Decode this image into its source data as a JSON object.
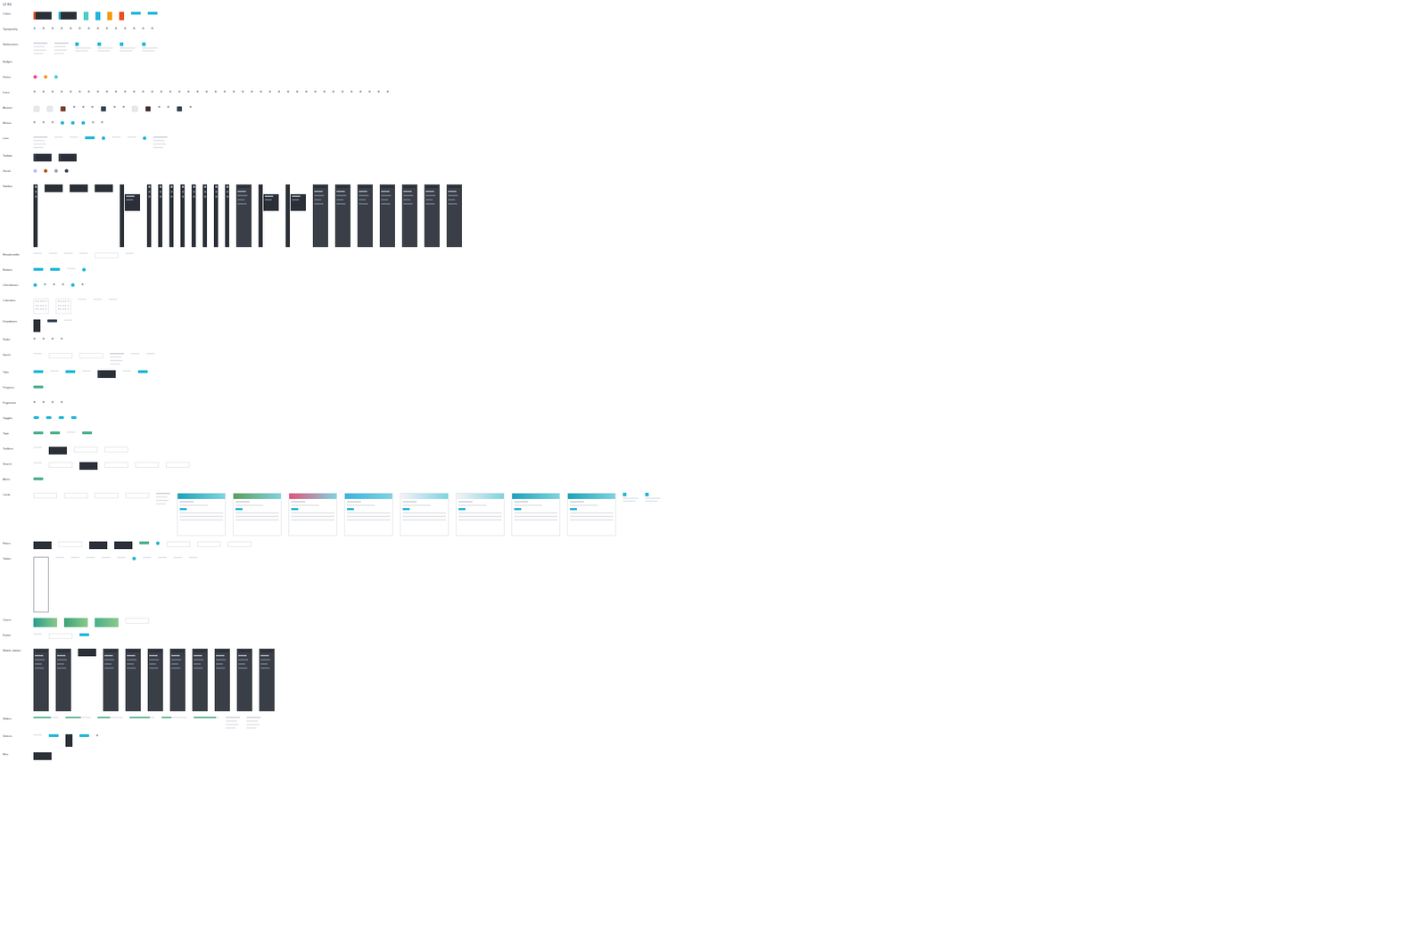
{
  "sheet": {
    "title": "UI Kit"
  },
  "sections": [
    {
      "label": "Colors",
      "items": [
        {
          "kind": "panel",
          "color": "#e8501f"
        },
        {
          "kind": "panel",
          "color": "#1fb6d9"
        },
        {
          "kind": "swatch",
          "color": "#4ecdc4"
        },
        {
          "kind": "swatch",
          "color": "#1fb6d9"
        },
        {
          "kind": "swatch",
          "color": "#f39c12"
        },
        {
          "kind": "swatch",
          "color": "#e8501f"
        },
        {
          "kind": "pill",
          "color": "#1fb6d9"
        },
        {
          "kind": "pill",
          "color": "#1fb6d9"
        }
      ]
    },
    {
      "label": "Typography",
      "items": [
        {
          "kind": "mark"
        },
        {
          "kind": "mark"
        },
        {
          "kind": "mark"
        },
        {
          "kind": "mark"
        },
        {
          "kind": "mark"
        },
        {
          "kind": "mark"
        },
        {
          "kind": "mark"
        },
        {
          "kind": "mark"
        },
        {
          "kind": "mark"
        },
        {
          "kind": "mark"
        },
        {
          "kind": "mark"
        },
        {
          "kind": "mark"
        },
        {
          "kind": "mark"
        },
        {
          "kind": "mark"
        }
      ]
    },
    {
      "label": "Notifications",
      "items": [
        {
          "kind": "list"
        },
        {
          "kind": "list"
        },
        {
          "kind": "note"
        },
        {
          "kind": "note"
        },
        {
          "kind": "note"
        },
        {
          "kind": "note"
        }
      ]
    },
    {
      "label": "Badges",
      "items": []
    },
    {
      "label": "Status",
      "items": [
        {
          "kind": "dot",
          "color": "#e84393"
        },
        {
          "kind": "dot",
          "color": "#f39c12"
        },
        {
          "kind": "dot",
          "color": "#4ecdc4"
        }
      ]
    },
    {
      "label": "Icons",
      "items": [
        {
          "kind": "mark"
        },
        {
          "kind": "mark"
        },
        {
          "kind": "mark"
        },
        {
          "kind": "mark"
        },
        {
          "kind": "mark"
        },
        {
          "kind": "mark"
        },
        {
          "kind": "mark"
        },
        {
          "kind": "mark"
        },
        {
          "kind": "mark"
        },
        {
          "kind": "mark"
        },
        {
          "kind": "mark"
        },
        {
          "kind": "mark"
        },
        {
          "kind": "mark"
        },
        {
          "kind": "mark"
        },
        {
          "kind": "mark"
        },
        {
          "kind": "mark"
        },
        {
          "kind": "mark"
        },
        {
          "kind": "mark"
        },
        {
          "kind": "mark"
        },
        {
          "kind": "mark"
        },
        {
          "kind": "mark"
        },
        {
          "kind": "mark"
        },
        {
          "kind": "mark"
        },
        {
          "kind": "mark"
        },
        {
          "kind": "mark"
        },
        {
          "kind": "mark"
        },
        {
          "kind": "mark"
        },
        {
          "kind": "mark"
        },
        {
          "kind": "mark"
        },
        {
          "kind": "mark"
        },
        {
          "kind": "mark"
        },
        {
          "kind": "mark"
        },
        {
          "kind": "mark"
        },
        {
          "kind": "mark"
        },
        {
          "kind": "mark"
        },
        {
          "kind": "mark"
        },
        {
          "kind": "mark"
        },
        {
          "kind": "mark"
        },
        {
          "kind": "mark"
        },
        {
          "kind": "mark"
        }
      ]
    },
    {
      "label": "Avatars",
      "items": [
        {
          "kind": "avatar",
          "color": "#e5e7eb"
        },
        {
          "kind": "avatar",
          "color": "#e5e7eb"
        },
        {
          "kind": "avatar",
          "color": "#7c3a2e"
        },
        {
          "kind": "mark"
        },
        {
          "kind": "mark"
        },
        {
          "kind": "mark"
        },
        {
          "kind": "avatar",
          "color": "#374151"
        },
        {
          "kind": "mark"
        },
        {
          "kind": "mark"
        },
        {
          "kind": "avatar",
          "color": "#e5e7eb"
        },
        {
          "kind": "avatar",
          "color": "#4b2e2e"
        },
        {
          "kind": "mark"
        },
        {
          "kind": "mark"
        },
        {
          "kind": "avatar",
          "color": "#374151"
        },
        {
          "kind": "mark"
        }
      ]
    },
    {
      "label": "Menus",
      "items": [
        {
          "kind": "mark"
        },
        {
          "kind": "mark"
        },
        {
          "kind": "mark"
        },
        {
          "kind": "dot",
          "color": "#1fb6d9"
        },
        {
          "kind": "dot",
          "color": "#1fb6d9"
        },
        {
          "kind": "dot",
          "color": "#1fb6d9"
        },
        {
          "kind": "mark"
        },
        {
          "kind": "mark"
        }
      ]
    },
    {
      "label": "Lists",
      "items": [
        {
          "kind": "list"
        },
        {
          "kind": "line"
        },
        {
          "kind": "line"
        },
        {
          "kind": "pill",
          "color": "#1fb6d9"
        },
        {
          "kind": "dot",
          "color": "#1fb6d9"
        },
        {
          "kind": "line"
        },
        {
          "kind": "line"
        },
        {
          "kind": "dot",
          "color": "#1fb6d9"
        },
        {
          "kind": "list"
        }
      ]
    },
    {
      "label": "Tooltips",
      "items": [
        {
          "kind": "panel",
          "color": "#374151"
        },
        {
          "kind": "panel",
          "color": "#374151"
        }
      ]
    },
    {
      "label": "Social",
      "items": [
        {
          "kind": "dot",
          "color": "#c4b5fd"
        },
        {
          "kind": "dot",
          "color": "#b45309"
        },
        {
          "kind": "dot",
          "color": "#9ca3af"
        },
        {
          "kind": "dot",
          "color": "#374151"
        }
      ]
    },
    {
      "label": "Sidebar",
      "items": [
        {
          "kind": "rail"
        },
        {
          "kind": "panel",
          "color": "#2b3038"
        },
        {
          "kind": "panel",
          "color": "#2b3038"
        },
        {
          "kind": "panel",
          "color": "#2b3038"
        },
        {
          "kind": "menu"
        },
        {
          "kind": "rail"
        },
        {
          "kind": "rail"
        },
        {
          "kind": "rail"
        },
        {
          "kind": "rail"
        },
        {
          "kind": "rail"
        },
        {
          "kind": "rail"
        },
        {
          "kind": "rail"
        },
        {
          "kind": "rail"
        },
        {
          "kind": "sidebar"
        },
        {
          "kind": "menu"
        },
        {
          "kind": "menu"
        },
        {
          "kind": "sidebar"
        },
        {
          "kind": "sidebar"
        },
        {
          "kind": "sidebar"
        },
        {
          "kind": "sidebar"
        },
        {
          "kind": "sidebar"
        },
        {
          "kind": "sidebar"
        },
        {
          "kind": "sidebar"
        }
      ]
    },
    {
      "label": "Breadcrumbs",
      "items": [
        {
          "kind": "line"
        },
        {
          "kind": "line"
        },
        {
          "kind": "line"
        },
        {
          "kind": "line"
        },
        {
          "kind": "box"
        },
        {
          "kind": "line"
        }
      ]
    },
    {
      "label": "Buttons",
      "items": [
        {
          "kind": "pill",
          "color": "#1fb6d9"
        },
        {
          "kind": "pill",
          "color": "#1fb6d9"
        },
        {
          "kind": "line"
        },
        {
          "kind": "dot",
          "color": "#1fb6d9"
        }
      ]
    },
    {
      "label": "Checkboxes",
      "items": [
        {
          "kind": "dot",
          "color": "#1fb6d9"
        },
        {
          "kind": "mark"
        },
        {
          "kind": "mark"
        },
        {
          "kind": "mark"
        },
        {
          "kind": "dot",
          "color": "#1fb6d9"
        },
        {
          "kind": "mark"
        }
      ]
    },
    {
      "label": "Calendars",
      "items": [
        {
          "kind": "calendar"
        },
        {
          "kind": "calendar"
        },
        {
          "kind": "line"
        },
        {
          "kind": "line"
        },
        {
          "kind": "line"
        }
      ]
    },
    {
      "label": "Dropdowns",
      "items": [
        {
          "kind": "menu-small"
        },
        {
          "kind": "pill",
          "color": "#374151"
        },
        {
          "kind": "line"
        }
      ]
    },
    {
      "label": "Radio",
      "items": [
        {
          "kind": "mark"
        },
        {
          "kind": "mark"
        },
        {
          "kind": "mark"
        },
        {
          "kind": "mark"
        }
      ]
    },
    {
      "label": "Inputs",
      "items": [
        {
          "kind": "line"
        },
        {
          "kind": "box"
        },
        {
          "kind": "box"
        },
        {
          "kind": "list"
        },
        {
          "kind": "line"
        },
        {
          "kind": "line"
        }
      ]
    },
    {
      "label": "Tabs",
      "items": [
        {
          "kind": "pill",
          "color": "#1fb6d9"
        },
        {
          "kind": "line"
        },
        {
          "kind": "pill",
          "color": "#1fb6d9"
        },
        {
          "kind": "line"
        },
        {
          "kind": "panel",
          "color": "#374151"
        },
        {
          "kind": "line"
        },
        {
          "kind": "pill",
          "color": "#1fb6d9"
        }
      ]
    },
    {
      "label": "Progress",
      "items": [
        {
          "kind": "pill",
          "color": "#4caf8a"
        }
      ]
    },
    {
      "label": "Pagination",
      "items": [
        {
          "kind": "mark"
        },
        {
          "kind": "mark"
        },
        {
          "kind": "mark"
        },
        {
          "kind": "mark"
        }
      ]
    },
    {
      "label": "Toggles",
      "items": [
        {
          "kind": "toggle"
        },
        {
          "kind": "toggle"
        },
        {
          "kind": "toggle"
        },
        {
          "kind": "toggle"
        }
      ]
    },
    {
      "label": "Tags",
      "items": [
        {
          "kind": "pill",
          "color": "#4caf8a"
        },
        {
          "kind": "pill",
          "color": "#4caf8a"
        },
        {
          "kind": "line"
        },
        {
          "kind": "pill",
          "color": "#4caf8a"
        }
      ]
    },
    {
      "label": "Toolbars",
      "items": [
        {
          "kind": "line"
        },
        {
          "kind": "panel",
          "color": "#2b3038"
        },
        {
          "kind": "box"
        },
        {
          "kind": "box"
        }
      ]
    },
    {
      "label": "Search",
      "items": [
        {
          "kind": "line"
        },
        {
          "kind": "box"
        },
        {
          "kind": "panel",
          "color": "#2b3038"
        },
        {
          "kind": "box"
        },
        {
          "kind": "box"
        },
        {
          "kind": "box"
        }
      ]
    },
    {
      "label": "Alerts",
      "items": [
        {
          "kind": "pill",
          "color": "#4caf8a"
        }
      ]
    },
    {
      "label": "Cards",
      "items": [
        {
          "kind": "box"
        },
        {
          "kind": "box"
        },
        {
          "kind": "box"
        },
        {
          "kind": "box"
        },
        {
          "kind": "list"
        },
        {
          "kind": "card",
          "color": "#1ca3b8"
        },
        {
          "kind": "card",
          "color": "#5aa05a"
        },
        {
          "kind": "card",
          "color": "#e2547a"
        },
        {
          "kind": "card",
          "color": "#3bb3e0"
        },
        {
          "kind": "card",
          "color": "#f3f4f6"
        },
        {
          "kind": "card",
          "color": "#f3f4f6"
        },
        {
          "kind": "card",
          "color": "#1ca3b8"
        },
        {
          "kind": "card",
          "color": "#1ca3b8"
        },
        {
          "kind": "note"
        },
        {
          "kind": "note"
        }
      ]
    },
    {
      "label": "Filters",
      "items": [
        {
          "kind": "panel",
          "color": "#2b3038"
        },
        {
          "kind": "box"
        },
        {
          "kind": "panel",
          "color": "#2b3038"
        },
        {
          "kind": "panel",
          "color": "#2b3038"
        },
        {
          "kind": "pill",
          "color": "#4caf8a"
        },
        {
          "kind": "dot",
          "color": "#1fb6d9"
        },
        {
          "kind": "box"
        },
        {
          "kind": "box"
        },
        {
          "kind": "box"
        }
      ]
    },
    {
      "label": "Tables",
      "items": [
        {
          "kind": "tall"
        },
        {
          "kind": "line"
        },
        {
          "kind": "line"
        },
        {
          "kind": "line"
        },
        {
          "kind": "line"
        },
        {
          "kind": "line"
        },
        {
          "kind": "dot",
          "color": "#1fb6d9"
        },
        {
          "kind": "line"
        },
        {
          "kind": "line"
        },
        {
          "kind": "line"
        },
        {
          "kind": "line"
        }
      ]
    },
    {
      "label": "Charts",
      "items": [
        {
          "kind": "banner",
          "color": "#2a9d8f"
        },
        {
          "kind": "banner",
          "color": "#3aa37a"
        },
        {
          "kind": "banner",
          "color": "#4caf8a"
        },
        {
          "kind": "box"
        }
      ]
    },
    {
      "label": "Footer",
      "items": [
        {
          "kind": "line"
        },
        {
          "kind": "box"
        },
        {
          "kind": "pill",
          "color": "#1fb6d9"
        }
      ]
    },
    {
      "label": "Mobile sidebar",
      "items": [
        {
          "kind": "sidebar"
        },
        {
          "kind": "sidebar"
        },
        {
          "kind": "panel",
          "color": "#2b3038"
        },
        {
          "kind": "sidebar"
        },
        {
          "kind": "sidebar"
        },
        {
          "kind": "sidebar"
        },
        {
          "kind": "sidebar"
        },
        {
          "kind": "sidebar"
        },
        {
          "kind": "sidebar"
        },
        {
          "kind": "sidebar"
        },
        {
          "kind": "sidebar"
        }
      ]
    },
    {
      "label": "Sliders",
      "items": [
        {
          "kind": "slider",
          "level": 0.7
        },
        {
          "kind": "slider",
          "level": 0.6
        },
        {
          "kind": "slider",
          "level": 0.5
        },
        {
          "kind": "slider",
          "level": 0.8
        },
        {
          "kind": "slider",
          "level": 0.4
        },
        {
          "kind": "slider",
          "level": 0.9
        },
        {
          "kind": "list"
        },
        {
          "kind": "list"
        }
      ]
    },
    {
      "label": "Selects",
      "items": [
        {
          "kind": "line"
        },
        {
          "kind": "pill",
          "color": "#1fb6d9"
        },
        {
          "kind": "menu-small"
        },
        {
          "kind": "pill",
          "color": "#1fb6d9"
        },
        {
          "kind": "mark"
        }
      ]
    },
    {
      "label": "Misc",
      "items": [
        {
          "kind": "panel",
          "color": "#2b3038"
        }
      ]
    }
  ]
}
